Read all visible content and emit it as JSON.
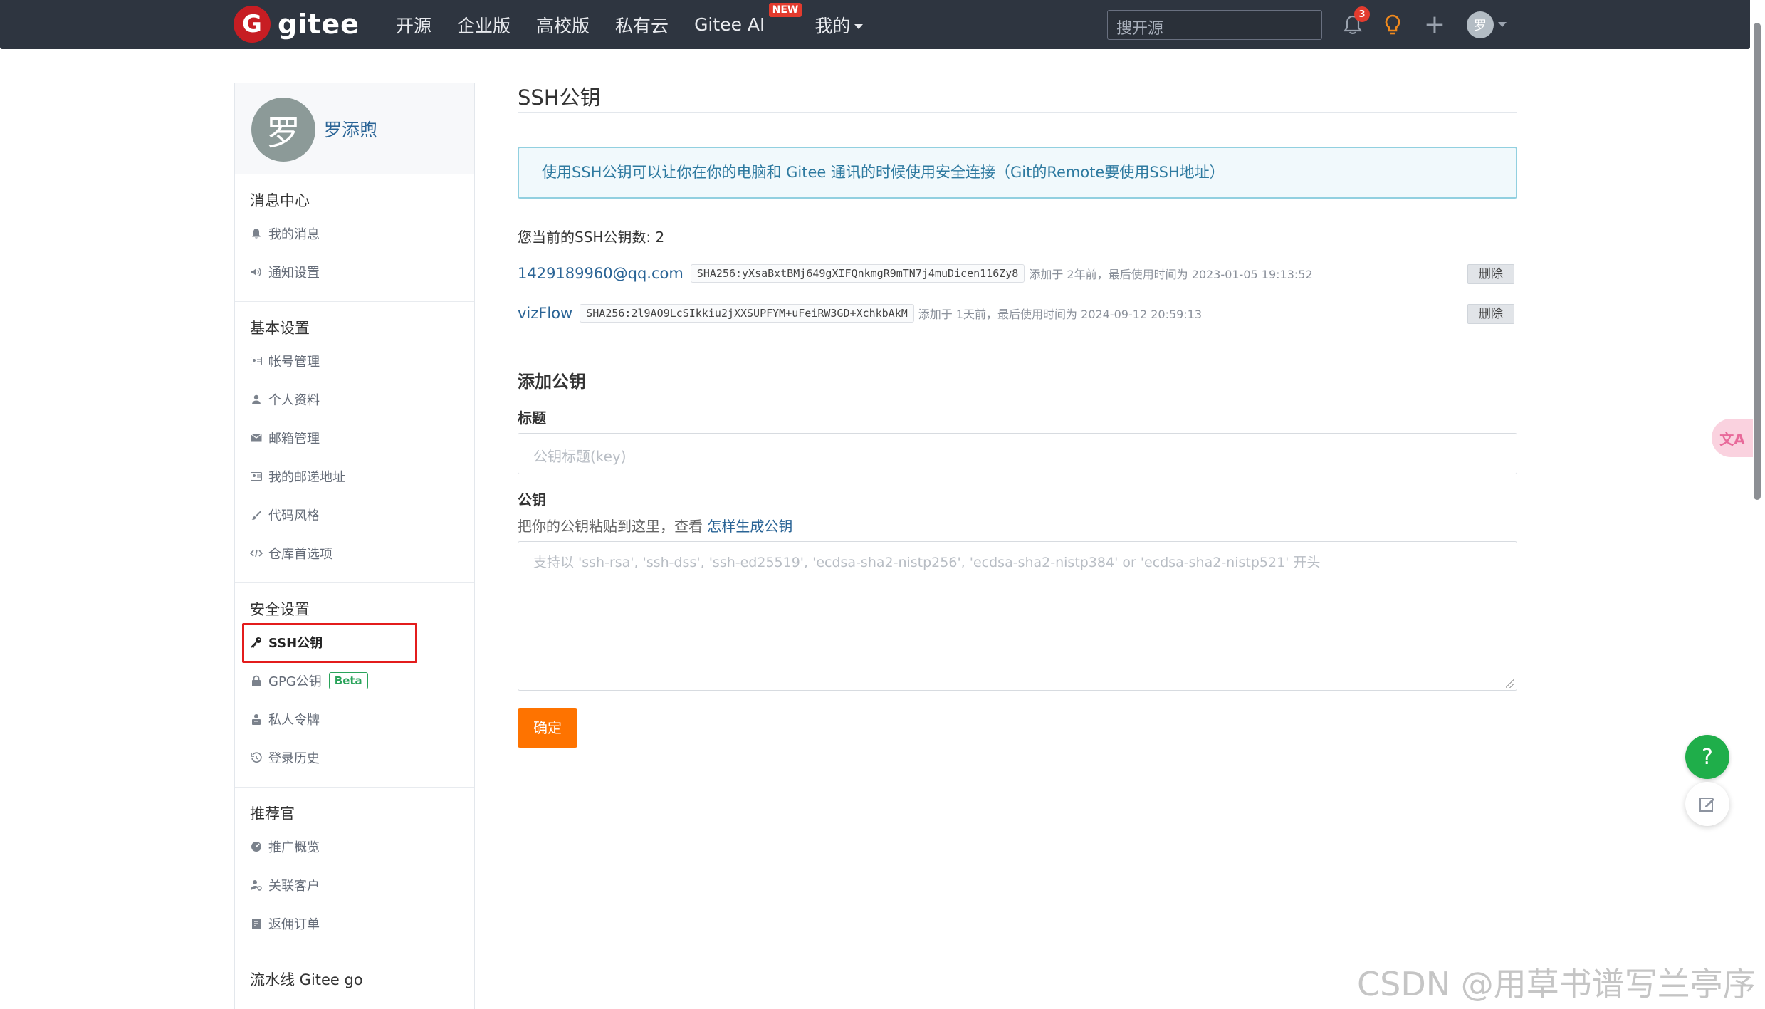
{
  "header": {
    "logo_text": "gitee",
    "nav": [
      "开源",
      "企业版",
      "高校版",
      "私有云",
      "Gitee AI",
      "我的"
    ],
    "new_badge": "NEW",
    "search_placeholder": "搜开源",
    "notification_count": "3",
    "avatar_initial": "罗",
    "colors": {
      "bar": "#2e3540",
      "logo": "#c71d23"
    }
  },
  "sidebar": {
    "profile": {
      "avatar_initial": "罗",
      "name": "罗添煦"
    },
    "groups": [
      {
        "title": "消息中心",
        "items": [
          {
            "label": "我的消息",
            "icon": "bell-icon"
          },
          {
            "label": "通知设置",
            "icon": "speaker-icon"
          }
        ]
      },
      {
        "title": "基本设置",
        "items": [
          {
            "label": "帐号管理",
            "icon": "id-card-icon"
          },
          {
            "label": "个人资料",
            "icon": "user-icon"
          },
          {
            "label": "邮箱管理",
            "icon": "envelope-icon"
          },
          {
            "label": "我的邮递地址",
            "icon": "address-card-icon"
          },
          {
            "label": "代码风格",
            "icon": "brush-icon"
          },
          {
            "label": "仓库首选项",
            "icon": "code-icon"
          }
        ]
      },
      {
        "title": "安全设置",
        "items": [
          {
            "label": "SSH公钥",
            "icon": "key-icon",
            "active": true
          },
          {
            "label": "GPG公钥",
            "icon": "lock-icon",
            "badge": "Beta"
          },
          {
            "label": "私人令牌",
            "icon": "token-icon"
          },
          {
            "label": "登录历史",
            "icon": "history-icon"
          }
        ]
      },
      {
        "title": "推荐官",
        "items": [
          {
            "label": "推广概览",
            "icon": "gauge-icon"
          },
          {
            "label": "关联客户",
            "icon": "user-link-icon"
          },
          {
            "label": "返佣订单",
            "icon": "receipt-icon"
          }
        ]
      },
      {
        "title": "流水线 Gitee go",
        "items": []
      }
    ]
  },
  "main": {
    "title": "SSH公钥",
    "info": "使用SSH公钥可以让你在你的电脑和 Gitee 通讯的时候使用安全连接（Git的Remote要使用SSH地址）",
    "count_text": "您当前的SSH公钥数: 2",
    "keys": [
      {
        "title": "1429189960@qq.com",
        "fingerprint": "SHA256:yXsaBxtBMj649gXIFQnkmgR9mTN7j4muDicen116Zy8",
        "meta": "添加于 2年前，最后使用时间为 2023-01-05 19:13:52",
        "delete": "删除"
      },
      {
        "title": "vizFlow",
        "fingerprint": "SHA256:2l9AO9LcSIkkiu2jXXSUPFYM+uFeiRW3GD+XchkbAkM",
        "meta": "添加于 1天前，最后使用时间为 2024-09-12 20:59:13",
        "delete": "删除"
      }
    ],
    "add_section_title": "添加公钥",
    "title_label": "标题",
    "title_placeholder": "公钥标题(key)",
    "key_label": "公钥",
    "help_text": "把你的公钥粘贴到这里，查看",
    "help_link": "怎样生成公钥",
    "key_placeholder": "支持以 'ssh-rsa', 'ssh-dss', 'ssh-ed25519', 'ecdsa-sha2-nistp256', 'ecdsa-sha2-nistp384' or 'ecdsa-sha2-nistp521' 开头",
    "submit_label": "确定",
    "accent_color": "#fe7300"
  },
  "floating": {
    "translate_label": "文A",
    "help_label": "?",
    "watermark": "CSDN @用草书谱写兰亭序"
  }
}
